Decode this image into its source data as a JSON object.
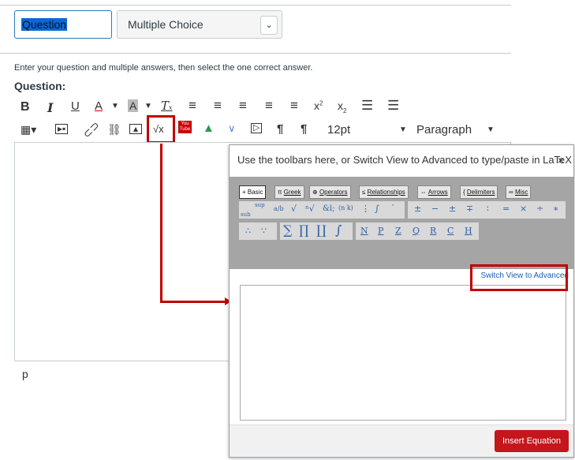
{
  "header": {
    "question_name": "Question",
    "question_type": "Multiple Choice"
  },
  "instructions": "Enter your question and multiple answers, then select the one correct answer.",
  "question_label": "Question:",
  "toolbar1": [
    "B",
    "I",
    "U",
    "A",
    "▾",
    "A",
    "▾",
    "T",
    "≡",
    "≡",
    "≡",
    "≡",
    "≡",
    "x²",
    "x₂",
    "☰",
    "☰"
  ],
  "toolbar2": {
    "table": "▦▾",
    "media": "▣",
    "link": "🔗",
    "unlink": "⛓",
    "image": "▨",
    "equation": "√x",
    "youtube": "You Tube",
    "gdrive": "▲",
    "apps": "∨",
    "embed": "▷",
    "ltr": "¶",
    "rtl": "¶",
    "font_size": "12pt",
    "paragraph": "Paragraph"
  },
  "editor_status": "p",
  "dialog": {
    "title": "Use the toolbars here, or Switch View to Advanced to type/paste in LaTeX",
    "close": "×",
    "tabs": [
      {
        "label": "+ Basic",
        "underline": ""
      },
      {
        "label": "π ",
        "underline": "Greek"
      },
      {
        "label": "⊕ ",
        "underline": "Operators"
      },
      {
        "label": "≤ ",
        "underline": "Relationships"
      },
      {
        "label": "⇔ ",
        "underline": "Arrows"
      },
      {
        "label": "{ ",
        "underline": "Delimiters"
      },
      {
        "label": "∞ ",
        "underline": "Misc"
      }
    ],
    "row1_symbols": [
      "sub",
      "sup",
      "a/b",
      "√",
      "ⁿ√",
      "&l;",
      "(n k)",
      "⋮",
      "∫",
      "′",
      "±",
      "−",
      "±",
      "∓",
      "∶",
      "=",
      "×",
      "÷",
      "∗"
    ],
    "row2_symbols": [
      "∴",
      "∵",
      "∑",
      "∏",
      "∐",
      "∫",
      "N",
      "P",
      "Z",
      "Q",
      "R",
      "C",
      "H"
    ],
    "switch_link": "Switch View to Advanced",
    "insert_button": "Insert Equation"
  },
  "colors": {
    "highlight": "#c00000",
    "insert_button": "#c4161c",
    "toolbar_gray": "#a5a5a5",
    "selection": "#0b68d6"
  }
}
